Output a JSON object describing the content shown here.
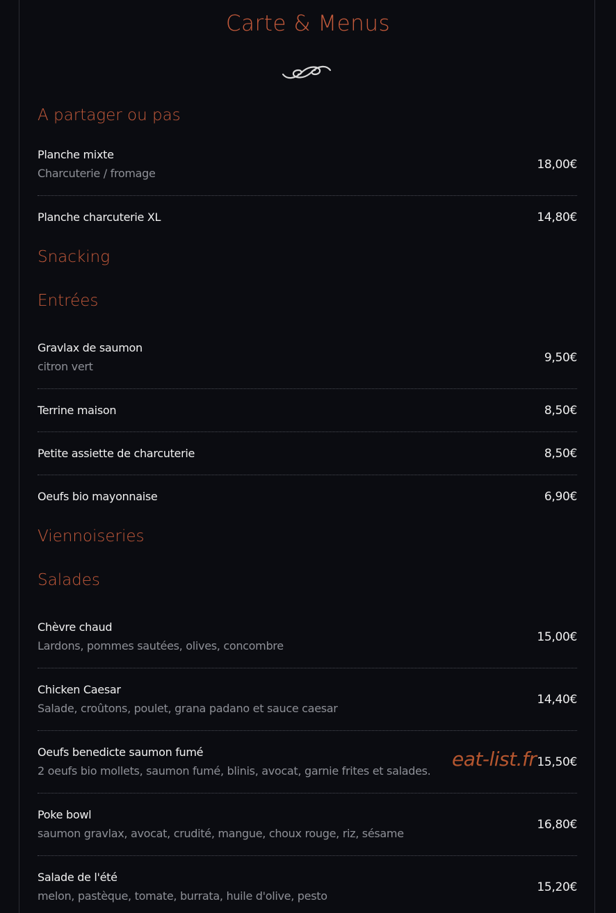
{
  "page": {
    "title": "Carte & Menus",
    "watermark": "eat-list.fr"
  },
  "colors": {
    "background": "#0b0c11",
    "accent": "#c45a3b",
    "text": "#f1f1f1",
    "muted": "#8e9097"
  },
  "icons": {
    "ornament": "flourish-ornament-icon"
  },
  "sections": [
    {
      "title": "A partager ou pas",
      "items": [
        {
          "name": "Planche mixte",
          "description": "Charcuterie / fromage",
          "price": "18,00€"
        },
        {
          "name": "Planche charcuterie XL",
          "description": "",
          "price": "14,80€"
        }
      ]
    },
    {
      "title": "Snacking",
      "items": []
    },
    {
      "title": "Entrées",
      "items": [
        {
          "name": "Gravlax de saumon",
          "description": "citron vert",
          "price": "9,50€"
        },
        {
          "name": "Terrine maison",
          "description": "",
          "price": "8,50€"
        },
        {
          "name": "Petite assiette de charcuterie",
          "description": "",
          "price": "8,50€"
        },
        {
          "name": "Oeufs bio mayonnaise",
          "description": "",
          "price": "6,90€"
        }
      ]
    },
    {
      "title": "Viennoiseries",
      "items": []
    },
    {
      "title": "Salades",
      "items": [
        {
          "name": "Chèvre chaud",
          "description": "Lardons, pommes sautées, olives, concombre",
          "price": "15,00€"
        },
        {
          "name": "Chicken Caesar",
          "description": "Salade, croûtons, poulet, grana padano et sauce caesar",
          "price": "14,40€"
        },
        {
          "name": "Oeufs benedicte saumon fumé",
          "description": "2 oeufs bio mollets, saumon fumé, blinis, avocat, garnie frites et salades.",
          "price": "15,50€"
        },
        {
          "name": "Poke bowl",
          "description": "saumon gravlax, avocat, crudité, mangue, choux rouge, riz, sésame",
          "price": "16,80€"
        },
        {
          "name": "Salade de l'été",
          "description": "melon, pastèque, tomate, burrata, huile d'olive, pesto",
          "price": "15,20€"
        }
      ]
    }
  ]
}
